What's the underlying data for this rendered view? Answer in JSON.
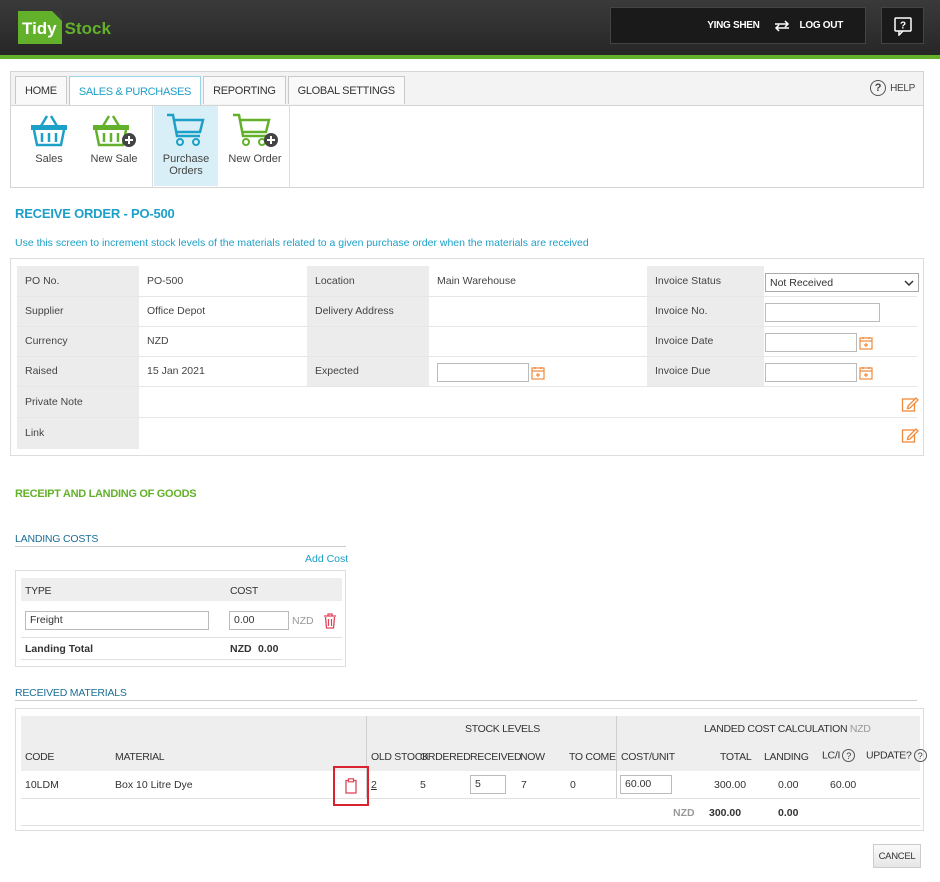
{
  "app": {
    "logo_part1": "Tidy",
    "logo_part2": "Stock",
    "user_name": "YING SHEN",
    "logout_label": "LOG OUT"
  },
  "nav": {
    "tabs": [
      {
        "label": "HOME"
      },
      {
        "label": "SALES & PURCHASES"
      },
      {
        "label": "REPORTING"
      },
      {
        "label": "GLOBAL SETTINGS"
      }
    ],
    "active_tab": "SALES & PURCHASES",
    "help_label": "HELP",
    "tools": [
      {
        "label": "Sales",
        "icon": "basket-icon"
      },
      {
        "label": "New Sale",
        "icon": "basket-add-icon"
      },
      {
        "label": "Purchase Orders",
        "icon": "cart-icon"
      },
      {
        "label": "New Order",
        "icon": "cart-add-icon"
      }
    ]
  },
  "page": {
    "title": "RECEIVE ORDER - PO-500",
    "description": "Use this screen to increment stock levels of the materials related to a given purchase order when the materials are received"
  },
  "info": {
    "po_no_label": "PO No.",
    "po_no": "PO-500",
    "location_label": "Location",
    "location": "Main Warehouse",
    "invoice_status_label": "Invoice Status",
    "invoice_status": "Not Received",
    "supplier_label": "Supplier",
    "supplier": "Office Depot",
    "delivery_address_label": "Delivery Address",
    "invoice_no_label": "Invoice No.",
    "currency_label": "Currency",
    "currency": "NZD",
    "invoice_date_label": "Invoice Date",
    "raised_label": "Raised",
    "raised": "15 Jan 2021",
    "expected_label": "Expected",
    "invoice_due_label": "Invoice Due",
    "private_note_label": "Private Note",
    "link_label": "Link"
  },
  "receipt": {
    "section_title": "RECEIPT AND LANDING OF GOODS",
    "landing_costs_title": "LANDING COSTS",
    "add_cost_label": "Add Cost",
    "col_type": "TYPE",
    "col_cost": "COST",
    "row_type": "Freight",
    "row_cost": "0.00",
    "row_currency": "NZD",
    "total_label": "Landing Total",
    "total_currency": "NZD",
    "total_value": "0.00"
  },
  "materials": {
    "title": "RECEIVED MATERIALS",
    "group_stock": "STOCK LEVELS",
    "group_landed": "LANDED COST CALCULATION",
    "group_landed_currency": "NZD",
    "columns": {
      "code": "CODE",
      "material": "MATERIAL",
      "old_stock": "OLD STOCK",
      "ordered": "ORDERED",
      "received": "RECEIVED",
      "now": "NOW",
      "to_come": "TO COME",
      "cost_unit": "COST/UNIT",
      "total": "TOTAL",
      "landing": "LANDING",
      "lci": "LC/I",
      "update": "UPDATE?"
    },
    "rows": [
      {
        "code": "10LDM",
        "material": "Box 10 Litre Dye",
        "old_stock": "2",
        "ordered": "5",
        "received": "5",
        "now": "7",
        "to_come": "0",
        "cost_unit": "60.00",
        "total": "300.00",
        "landing": "0.00",
        "lci": "60.00"
      }
    ],
    "footer_currency": "NZD",
    "footer_total": "300.00",
    "footer_landing": "0.00"
  },
  "actions": {
    "cancel_label": "CANCEL"
  },
  "colors": {
    "brand_green": "#63b12b",
    "accent_blue": "#1da0c8",
    "calendar_orange": "#f08a3c",
    "delete_red": "#e0455a",
    "highlight_red": "#d9232d"
  }
}
